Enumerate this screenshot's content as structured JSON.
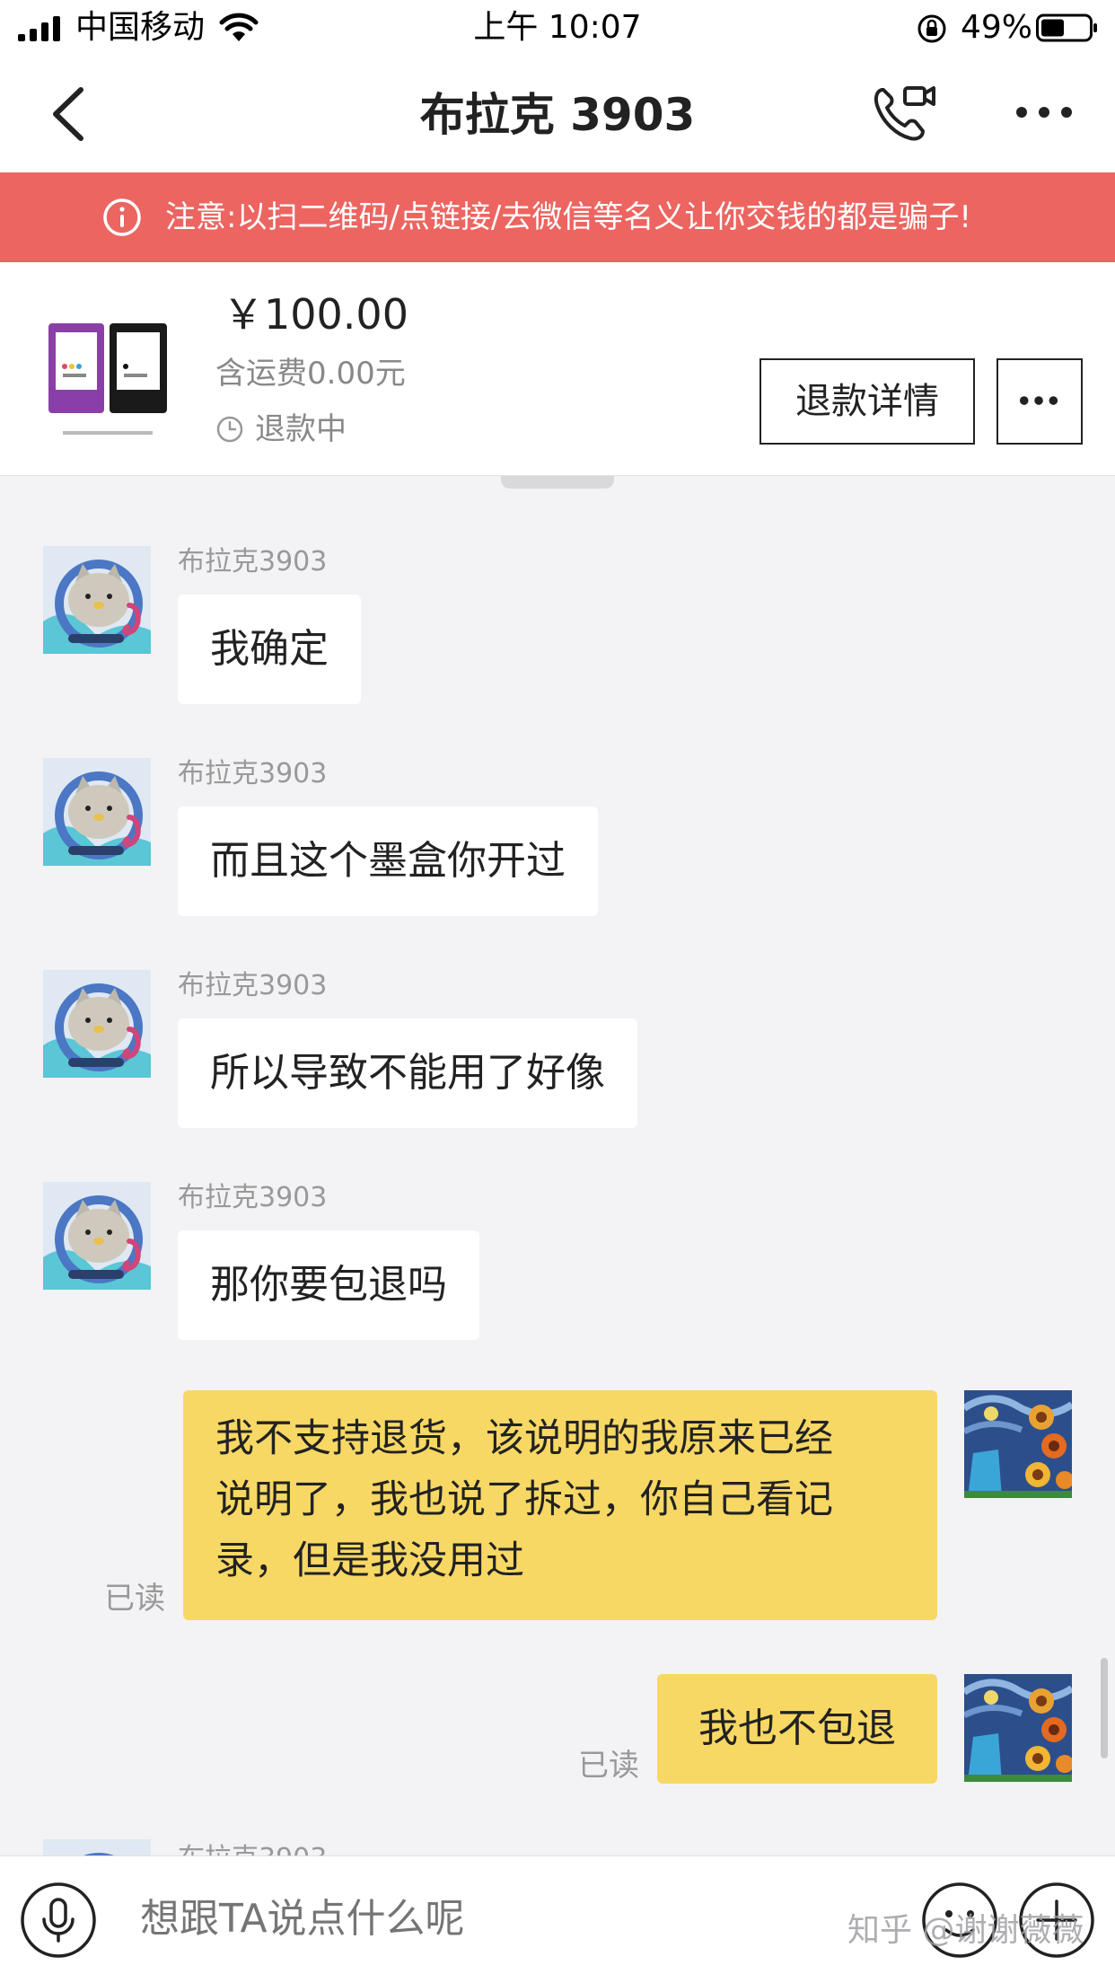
{
  "status_bar": {
    "carrier": "中国移动",
    "time": "上午 10:07",
    "battery_percent": "49%",
    "battery_level": 0.49
  },
  "nav": {
    "title": "布拉克 3903"
  },
  "warning": {
    "text": "注意:以扫二维码/点链接/去微信等名义让你交钱的都是骗子!"
  },
  "product": {
    "price": "￥100.00",
    "shipping": "含运费0.00元",
    "status": "退款中",
    "refund_button": "退款详情"
  },
  "messages": [
    {
      "sender": "布拉克3903",
      "text": "我确定"
    },
    {
      "sender": "布拉克3903",
      "text": "而且这个墨盒你开过"
    },
    {
      "sender": "布拉克3903",
      "text": "所以导致不能用了好像"
    },
    {
      "sender": "布拉克3903",
      "text": "那你要包退吗"
    }
  ],
  "outgoing": [
    {
      "lines": [
        "我不支持退货，该说明的我原来已经",
        "说明了，我也说了拆过，你自己看记",
        "录，但是我没用过"
      ],
      "status": "已读"
    },
    {
      "lines": [
        "我也不包退"
      ],
      "status": "已读"
    }
  ],
  "input": {
    "placeholder": "想跟TA说点什么呢"
  },
  "watermark": "知乎 @谢谢薇薇",
  "colors": {
    "warning_bg": "#ec6561",
    "outgoing_bubble": "#f8d864",
    "chat_bg": "#f3f3f5"
  },
  "icons": [
    "signal-icon",
    "wifi-icon",
    "orientation-lock-icon",
    "battery-icon",
    "back-icon",
    "video-call-icon",
    "more-icon",
    "info-icon",
    "clock-icon",
    "microphone-icon",
    "emoji-icon",
    "plus-icon"
  ]
}
